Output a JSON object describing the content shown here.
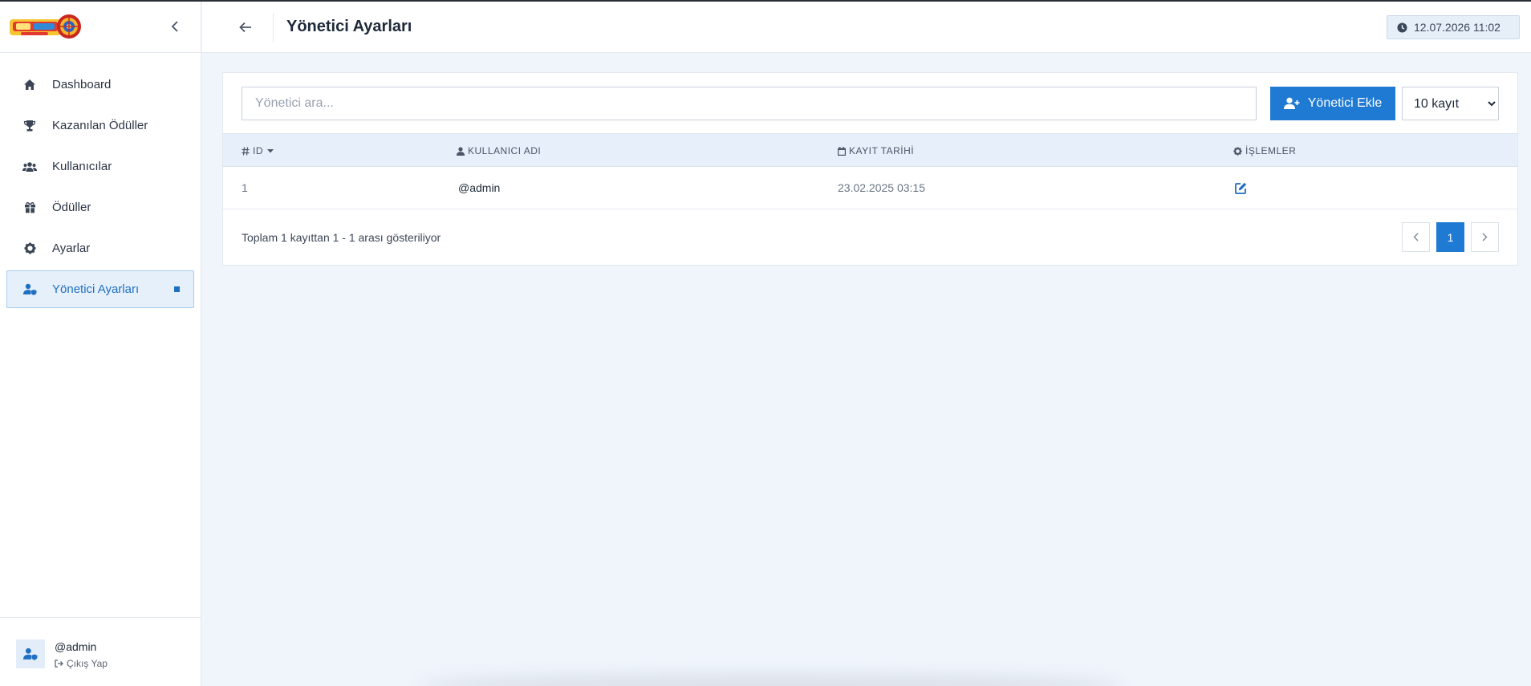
{
  "sidebar": {
    "items": [
      {
        "label": "Dashboard",
        "icon": "home-icon"
      },
      {
        "label": "Kazanılan Ödüller",
        "icon": "trophy-icon"
      },
      {
        "label": "Kullanıcılar",
        "icon": "users-icon"
      },
      {
        "label": "Ödüller",
        "icon": "gift-icon"
      },
      {
        "label": "Ayarlar",
        "icon": "gear-icon"
      },
      {
        "label": "Yönetici Ayarları",
        "icon": "user-shield-icon",
        "active": true
      }
    ],
    "user": {
      "name": "@admin",
      "logout_label": "Çıkış Yap"
    }
  },
  "header": {
    "title": "Yönetici Ayarları",
    "datetime": "12.07.2026 11:02"
  },
  "toolbar": {
    "search_placeholder": "Yönetici ara...",
    "add_label": "Yönetici Ekle",
    "per_page": "10 kayıt",
    "per_page_options": [
      "10 kayıt"
    ]
  },
  "table": {
    "columns": [
      "ID",
      "KULLANICI ADI",
      "KAYIT TARİHİ",
      "İŞLEMLER"
    ],
    "rows": [
      {
        "id": "1",
        "username": "@admin",
        "date": "23.02.2025 03:15"
      }
    ],
    "footer": "Toplam 1 kayıttan 1 - 1 arası gösteriliyor",
    "pages": [
      "1"
    ]
  },
  "colors": {
    "accent": "#1f7ad3",
    "active_bg": "#e6f0fb",
    "page_bg": "#f0f5fc"
  }
}
